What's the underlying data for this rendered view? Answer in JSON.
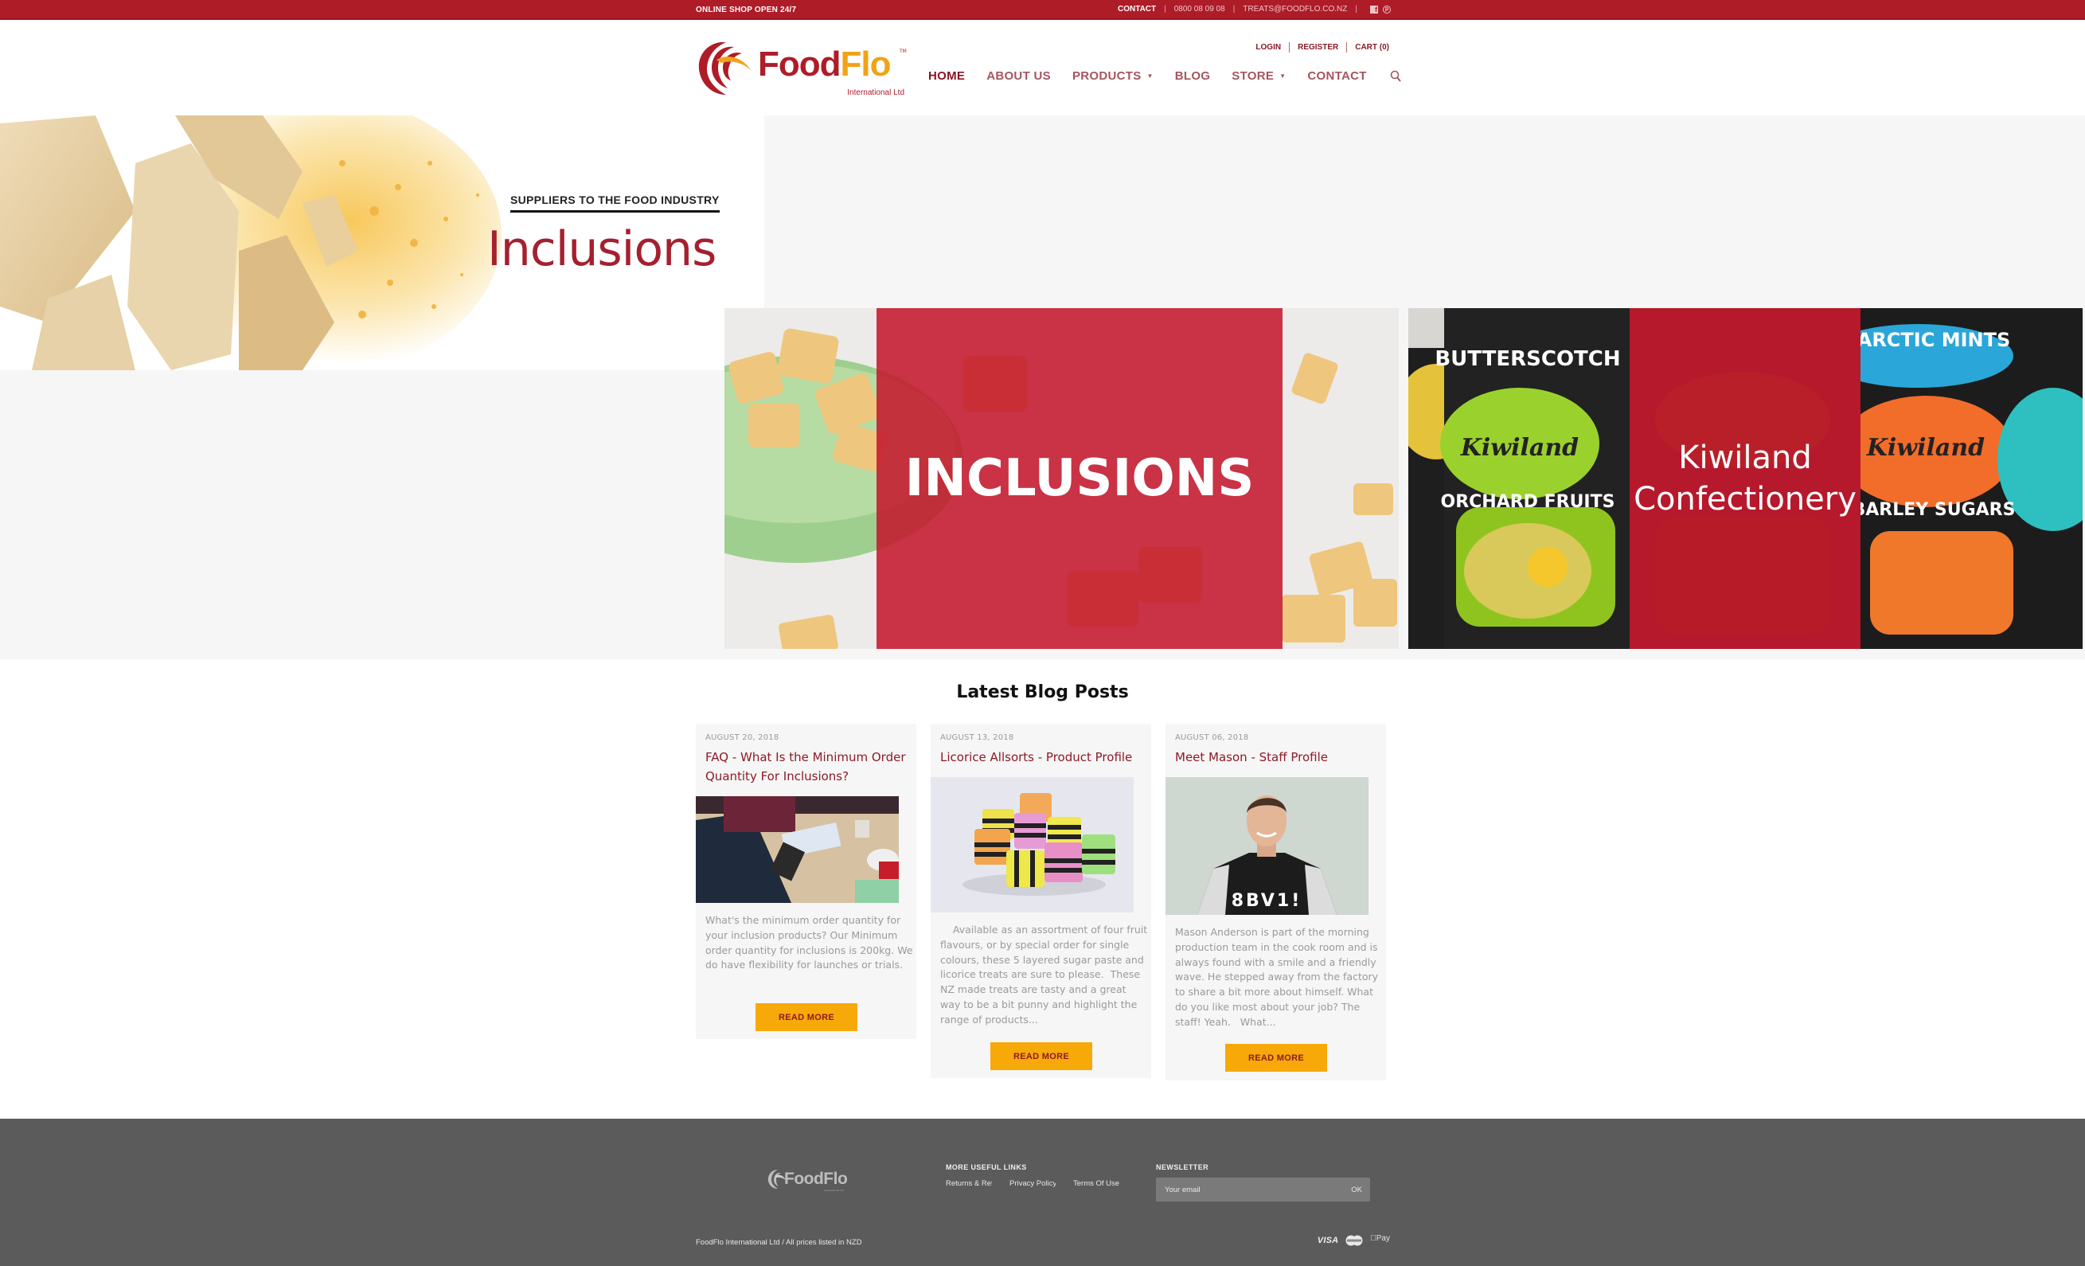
{
  "topbar": {
    "tagline": "ONLINE SHOP OPEN 24/7",
    "contact_label": "CONTACT",
    "phone": "0800 08 09 08",
    "email": "TREATS@FOODFLO.CO.NZ",
    "social": [
      "facebook-icon",
      "pinterest-icon"
    ]
  },
  "brand": {
    "name_part1": "Food",
    "name_part2": "Flo",
    "trademark": "TM",
    "subtitle": "International Ltd",
    "colors": {
      "primary": "#ae1c28",
      "accent": "#f0a318",
      "button": "#f7a90a"
    }
  },
  "account": {
    "login": "LOGIN",
    "register": "REGISTER",
    "cart": "CART (0)"
  },
  "nav": {
    "items": [
      {
        "label": "HOME",
        "active": true,
        "dropdown": false
      },
      {
        "label": "ABOUT US",
        "active": false,
        "dropdown": false
      },
      {
        "label": "PRODUCTS",
        "active": false,
        "dropdown": true
      },
      {
        "label": "BLOG",
        "active": false,
        "dropdown": false
      },
      {
        "label": "STORE",
        "active": false,
        "dropdown": true
      },
      {
        "label": "CONTACT",
        "active": false,
        "dropdown": false
      }
    ],
    "caret": "▼",
    "search_icon": "search-icon"
  },
  "hero": {
    "tagline": "SUPPLIERS TO THE FOOD INDUSTRY",
    "title": "Inclusions"
  },
  "tiles": [
    {
      "label": "INCLUSIONS"
    },
    {
      "label_line1": "Kiwiland",
      "label_line2": "Confectionery"
    }
  ],
  "blog": {
    "heading": "Latest Blog Posts",
    "posts": [
      {
        "date": "AUGUST 20, 2018",
        "title": "FAQ - What Is the Minimum Order Quantity For Inclusions?",
        "excerpt": "What's the minimum order quantity for your inclusion products? Our Minimum order quantity for inclusions is 200kg. We do have flexibility for launches or trials.",
        "button": "READ MORE"
      },
      {
        "date": "AUGUST 13, 2018",
        "title": "Licorice Allsorts - Product Profile",
        "excerpt": "    Available as an assortment of four fruit flavours, or by special order for single colours, these 5 layered sugar paste and licorice treats are sure to please.  These NZ made treats are tasty and a great way to be a bit punny and highlight the range of products...",
        "button": "READ MORE"
      },
      {
        "date": "AUGUST 06, 2018",
        "title": "Meet Mason - Staff Profile",
        "excerpt": "Mason Anderson is part of the morning production team in the cook room and is always found with a smile and a friendly wave. He stepped away from the factory to share a bit more about himself. What do you like most about your job? The staff! Yeah.   What...",
        "button": "READ MORE"
      }
    ]
  },
  "footer": {
    "logo_text": "FoodFlo",
    "logo_sub": "International Ltd",
    "links_heading": "MORE USEFUL LINKS",
    "links": [
      "Returns & Refunds",
      "Privacy Policy",
      "Terms Of Use"
    ],
    "newsletter_heading": "NEWSLETTER",
    "newsletter_placeholder": "Your email",
    "newsletter_button": "OK",
    "copyright": "FoodFlo International Ltd / All prices listed in NZD",
    "payments": {
      "visa": "VISA",
      "mastercard": "mastercard-icon",
      "applepay": "Pay"
    }
  }
}
